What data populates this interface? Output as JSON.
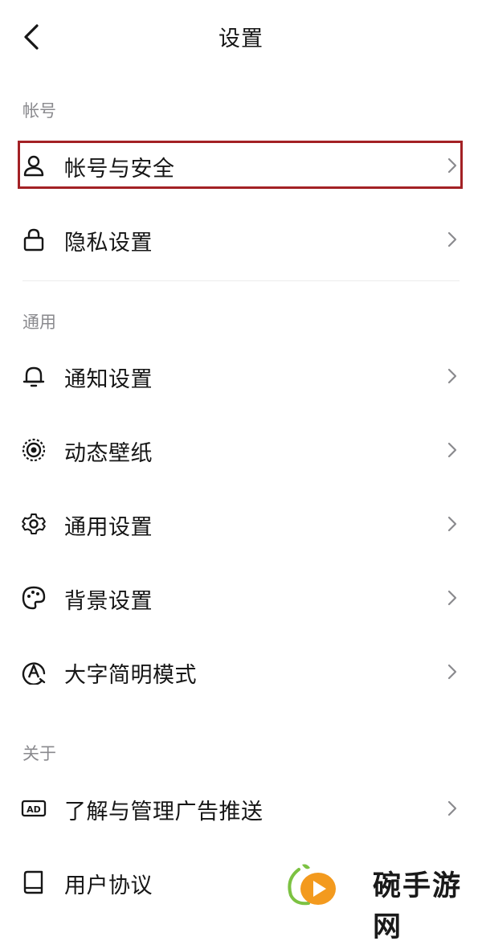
{
  "header": {
    "title": "设置"
  },
  "sections": {
    "account": {
      "label": "帐号",
      "items": [
        {
          "label": "帐号与安全",
          "icon": "person-icon"
        },
        {
          "label": "隐私设置",
          "icon": "lock-icon"
        }
      ]
    },
    "general": {
      "label": "通用",
      "items": [
        {
          "label": "通知设置",
          "icon": "bell-icon"
        },
        {
          "label": "动态壁纸",
          "icon": "wallpaper-icon"
        },
        {
          "label": "通用设置",
          "icon": "gear-icon"
        },
        {
          "label": "背景设置",
          "icon": "palette-icon"
        },
        {
          "label": "大字简明模式",
          "icon": "large-text-icon"
        }
      ]
    },
    "about": {
      "label": "关于",
      "items": [
        {
          "label": "了解与管理广告推送",
          "icon": "ad-icon"
        },
        {
          "label": "用户协议",
          "icon": "book-icon"
        }
      ]
    }
  },
  "watermark": {
    "text": "碗手游网"
  },
  "colors": {
    "highlight": "#a32125",
    "section_label": "#8a8a8e",
    "text": "#161616"
  }
}
